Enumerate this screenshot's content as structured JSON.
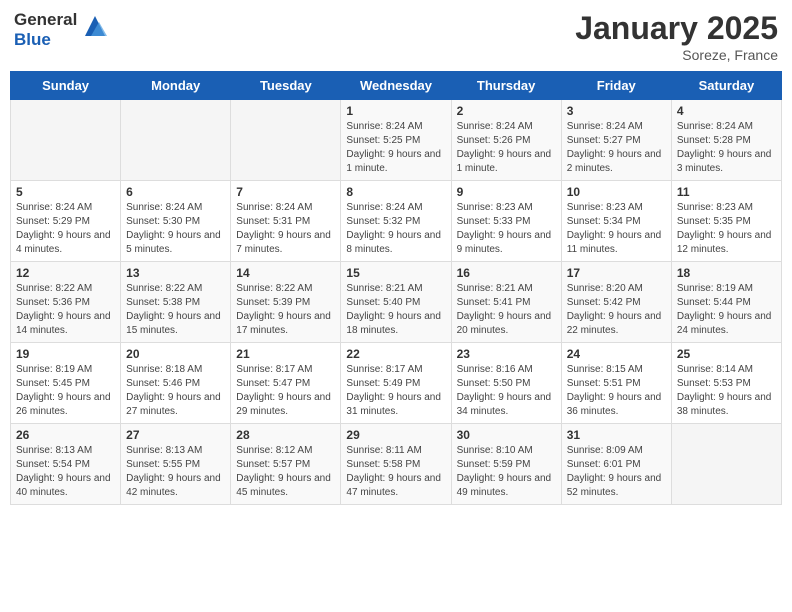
{
  "header": {
    "logo_line1": "General",
    "logo_line2": "Blue",
    "month": "January 2025",
    "location": "Soreze, France"
  },
  "weekdays": [
    "Sunday",
    "Monday",
    "Tuesday",
    "Wednesday",
    "Thursday",
    "Friday",
    "Saturday"
  ],
  "weeks": [
    [
      {
        "day": "",
        "sunrise": "",
        "sunset": "",
        "daylight": ""
      },
      {
        "day": "",
        "sunrise": "",
        "sunset": "",
        "daylight": ""
      },
      {
        "day": "",
        "sunrise": "",
        "sunset": "",
        "daylight": ""
      },
      {
        "day": "1",
        "sunrise": "Sunrise: 8:24 AM",
        "sunset": "Sunset: 5:25 PM",
        "daylight": "Daylight: 9 hours and 1 minute."
      },
      {
        "day": "2",
        "sunrise": "Sunrise: 8:24 AM",
        "sunset": "Sunset: 5:26 PM",
        "daylight": "Daylight: 9 hours and 1 minute."
      },
      {
        "day": "3",
        "sunrise": "Sunrise: 8:24 AM",
        "sunset": "Sunset: 5:27 PM",
        "daylight": "Daylight: 9 hours and 2 minutes."
      },
      {
        "day": "4",
        "sunrise": "Sunrise: 8:24 AM",
        "sunset": "Sunset: 5:28 PM",
        "daylight": "Daylight: 9 hours and 3 minutes."
      }
    ],
    [
      {
        "day": "5",
        "sunrise": "Sunrise: 8:24 AM",
        "sunset": "Sunset: 5:29 PM",
        "daylight": "Daylight: 9 hours and 4 minutes."
      },
      {
        "day": "6",
        "sunrise": "Sunrise: 8:24 AM",
        "sunset": "Sunset: 5:30 PM",
        "daylight": "Daylight: 9 hours and 5 minutes."
      },
      {
        "day": "7",
        "sunrise": "Sunrise: 8:24 AM",
        "sunset": "Sunset: 5:31 PM",
        "daylight": "Daylight: 9 hours and 7 minutes."
      },
      {
        "day": "8",
        "sunrise": "Sunrise: 8:24 AM",
        "sunset": "Sunset: 5:32 PM",
        "daylight": "Daylight: 9 hours and 8 minutes."
      },
      {
        "day": "9",
        "sunrise": "Sunrise: 8:23 AM",
        "sunset": "Sunset: 5:33 PM",
        "daylight": "Daylight: 9 hours and 9 minutes."
      },
      {
        "day": "10",
        "sunrise": "Sunrise: 8:23 AM",
        "sunset": "Sunset: 5:34 PM",
        "daylight": "Daylight: 9 hours and 11 minutes."
      },
      {
        "day": "11",
        "sunrise": "Sunrise: 8:23 AM",
        "sunset": "Sunset: 5:35 PM",
        "daylight": "Daylight: 9 hours and 12 minutes."
      }
    ],
    [
      {
        "day": "12",
        "sunrise": "Sunrise: 8:22 AM",
        "sunset": "Sunset: 5:36 PM",
        "daylight": "Daylight: 9 hours and 14 minutes."
      },
      {
        "day": "13",
        "sunrise": "Sunrise: 8:22 AM",
        "sunset": "Sunset: 5:38 PM",
        "daylight": "Daylight: 9 hours and 15 minutes."
      },
      {
        "day": "14",
        "sunrise": "Sunrise: 8:22 AM",
        "sunset": "Sunset: 5:39 PM",
        "daylight": "Daylight: 9 hours and 17 minutes."
      },
      {
        "day": "15",
        "sunrise": "Sunrise: 8:21 AM",
        "sunset": "Sunset: 5:40 PM",
        "daylight": "Daylight: 9 hours and 18 minutes."
      },
      {
        "day": "16",
        "sunrise": "Sunrise: 8:21 AM",
        "sunset": "Sunset: 5:41 PM",
        "daylight": "Daylight: 9 hours and 20 minutes."
      },
      {
        "day": "17",
        "sunrise": "Sunrise: 8:20 AM",
        "sunset": "Sunset: 5:42 PM",
        "daylight": "Daylight: 9 hours and 22 minutes."
      },
      {
        "day": "18",
        "sunrise": "Sunrise: 8:19 AM",
        "sunset": "Sunset: 5:44 PM",
        "daylight": "Daylight: 9 hours and 24 minutes."
      }
    ],
    [
      {
        "day": "19",
        "sunrise": "Sunrise: 8:19 AM",
        "sunset": "Sunset: 5:45 PM",
        "daylight": "Daylight: 9 hours and 26 minutes."
      },
      {
        "day": "20",
        "sunrise": "Sunrise: 8:18 AM",
        "sunset": "Sunset: 5:46 PM",
        "daylight": "Daylight: 9 hours and 27 minutes."
      },
      {
        "day": "21",
        "sunrise": "Sunrise: 8:17 AM",
        "sunset": "Sunset: 5:47 PM",
        "daylight": "Daylight: 9 hours and 29 minutes."
      },
      {
        "day": "22",
        "sunrise": "Sunrise: 8:17 AM",
        "sunset": "Sunset: 5:49 PM",
        "daylight": "Daylight: 9 hours and 31 minutes."
      },
      {
        "day": "23",
        "sunrise": "Sunrise: 8:16 AM",
        "sunset": "Sunset: 5:50 PM",
        "daylight": "Daylight: 9 hours and 34 minutes."
      },
      {
        "day": "24",
        "sunrise": "Sunrise: 8:15 AM",
        "sunset": "Sunset: 5:51 PM",
        "daylight": "Daylight: 9 hours and 36 minutes."
      },
      {
        "day": "25",
        "sunrise": "Sunrise: 8:14 AM",
        "sunset": "Sunset: 5:53 PM",
        "daylight": "Daylight: 9 hours and 38 minutes."
      }
    ],
    [
      {
        "day": "26",
        "sunrise": "Sunrise: 8:13 AM",
        "sunset": "Sunset: 5:54 PM",
        "daylight": "Daylight: 9 hours and 40 minutes."
      },
      {
        "day": "27",
        "sunrise": "Sunrise: 8:13 AM",
        "sunset": "Sunset: 5:55 PM",
        "daylight": "Daylight: 9 hours and 42 minutes."
      },
      {
        "day": "28",
        "sunrise": "Sunrise: 8:12 AM",
        "sunset": "Sunset: 5:57 PM",
        "daylight": "Daylight: 9 hours and 45 minutes."
      },
      {
        "day": "29",
        "sunrise": "Sunrise: 8:11 AM",
        "sunset": "Sunset: 5:58 PM",
        "daylight": "Daylight: 9 hours and 47 minutes."
      },
      {
        "day": "30",
        "sunrise": "Sunrise: 8:10 AM",
        "sunset": "Sunset: 5:59 PM",
        "daylight": "Daylight: 9 hours and 49 minutes."
      },
      {
        "day": "31",
        "sunrise": "Sunrise: 8:09 AM",
        "sunset": "Sunset: 6:01 PM",
        "daylight": "Daylight: 9 hours and 52 minutes."
      },
      {
        "day": "",
        "sunrise": "",
        "sunset": "",
        "daylight": ""
      }
    ]
  ]
}
